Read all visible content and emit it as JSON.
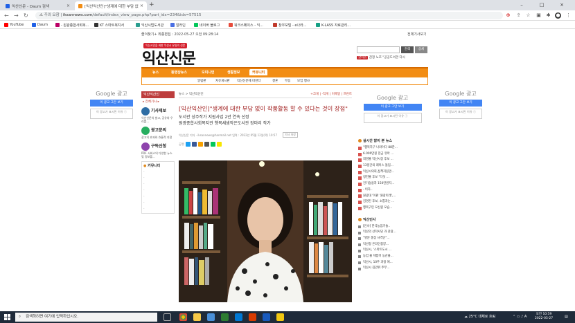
{
  "browser": {
    "tabs": [
      {
        "title": "익산신문 - Daum 검색",
        "active": false
      },
      {
        "title": "[익산익산인]\"생계에 대한 부담 없",
        "active": true
      }
    ],
    "address": {
      "warning": "주의 요함",
      "host": "iksannews.com",
      "path": "/default/index_view_page.php?part_idx=234&idx=57515"
    },
    "bookmarks": [
      "YouTube",
      "Daum",
      "- 원광종합사회복...",
      "KT 스마트복지서",
      "익산시립도서관",
      "알라딘",
      "네이버 블로그",
      "워크스페이스 - 익...",
      "창우포털 - e나라...",
      "K-LASS 자료관리..."
    ]
  },
  "site": {
    "toplinks": "즐겨찾기+   최종편집 : 2022-05-27 오전 09:28:14",
    "topright": "전체기사보기",
    "tagline": "익산시민을 위한 익산시 유일의 신문",
    "logo": "익산신문",
    "search_btn": "검색",
    "detail_btn": "상세",
    "hot_label": "핫이슈",
    "hot_text": "감정 노조   \"공공도서관 다시",
    "gnb": [
      "뉴스",
      "동영상뉴스",
      "오피니언",
      "생활정보",
      "커뮤니티"
    ],
    "gnb_active": "커뮤니티",
    "sub_menu": [
      "알림판",
      "자유게시판",
      "익산신문에 바란다",
      "결혼",
      "부음",
      "모임 행사"
    ]
  },
  "left": {
    "section": "익산익산인",
    "all": "▸ 전체기사 ▸",
    "boxes": [
      {
        "title": "기사제보",
        "desc": "익산신문의 발고, 공유와 우리를...",
        "color": "#2e6da4"
      },
      {
        "title": "광고문의",
        "desc": "광고의 효과와 효율적 지정",
        "color": "#27ae60"
      },
      {
        "title": "구독신청",
        "desc": "PDF 서비스의 다양한 뉴스 및 정보를...",
        "color": "#8e44ad"
      }
    ],
    "sns_title": "커뮤니티"
  },
  "article": {
    "crumb": "뉴스 > 익산익산인",
    "tools": "+크게 | -작게 | 이메일 | 프린트",
    "headline": "[익산익산인]\"생계에 대한 부담 없이 작품활동 할 수 있다는 것이 장점\"",
    "subline": "도서관 상주작가 지원사업 2년 연속 선정\n원광종합사회복지관 행복새샘작은도서관 장마리 작가",
    "byline": "익산신문 기자 · iksannews@hanmail.net   입력 : 2022년 05월 12일(목) 10:57",
    "print_btn": "기사 저장",
    "share_label": "공유"
  },
  "ads": {
    "google": "Google 광고",
    "stop": "이 광고 그만 보기",
    "why": "이 광고가 표시된 이유 ⓘ"
  },
  "right": {
    "popular_title": "실시간 많이 본 뉴스",
    "popular": [
      "\"행복하구 나라이다 88한...",
      "6.000만원 현금 유아 ...",
      "최경율 익산시장 후보 ...",
      "13일간의 레이스 돌입...",
      "익산시의회,정책지원관...",
      "정헌율 후보 \"다섯 ...",
      "전기승용차 150만원지...",
      "- 이하..",
      "원광대 '이판 '원광미래',...",
      "김경진 후보, 소통과는 ...",
      "행복구민 모산원 모습..."
    ],
    "local_title": "익산인사",
    "local": [
      "[인사] 한국농업기술..",
      "익산의 선학사당 과 관광...",
      "\"명문 풍장 사격단\"...",
      "익산형 온라인종양...",
      "익산시, '스마트도시 ...",
      "농업 불 체험어 농산물...",
      "익산시, 10주 과정 에...",
      "익산시 김관위 주부..."
    ]
  },
  "taskbar": {
    "search": "검색하려면 여기에 입력하십시오.",
    "weather": "25°C 대체로 흐림",
    "time": "오전 10:59",
    "date": "2022-05-27"
  }
}
